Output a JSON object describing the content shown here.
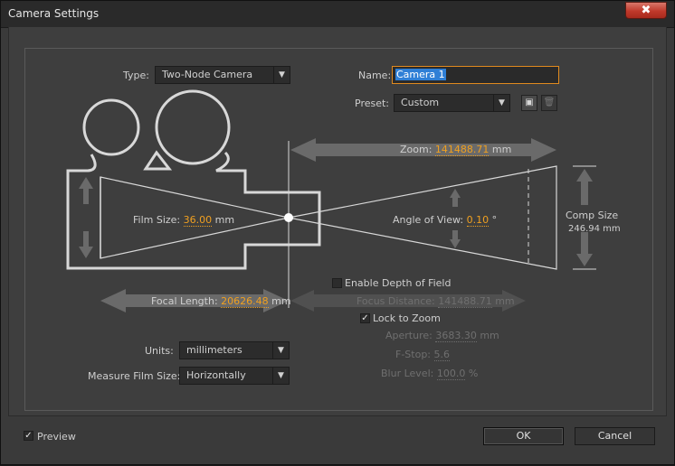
{
  "window": {
    "title": "Camera Settings",
    "close_label": "✖"
  },
  "type": {
    "label": "Type:",
    "value": "Two-Node Camera"
  },
  "name": {
    "label": "Name:",
    "value": "Camera 1"
  },
  "preset": {
    "label": "Preset:",
    "value": "Custom"
  },
  "diagram": {
    "zoom": {
      "label": "Zoom:",
      "value": "141488.71",
      "unit": "mm"
    },
    "film_size": {
      "label": "Film Size:",
      "value": "36.00",
      "unit": "mm"
    },
    "angle_of_view": {
      "label": "Angle of View:",
      "value": "0.10",
      "unit": "°"
    },
    "comp_size": {
      "label": "Comp Size",
      "value": "246.94 mm"
    },
    "focal_length": {
      "label": "Focal Length:",
      "value": "20626.48",
      "unit": "mm"
    }
  },
  "depth_of_field": {
    "enable_label": "Enable Depth of Field",
    "enabled": false,
    "focus_distance": {
      "label": "Focus Distance:",
      "value": "141488.71",
      "unit": "mm"
    },
    "lock_to_zoom_label": "Lock to Zoom",
    "lock_to_zoom": true,
    "aperture": {
      "label": "Aperture:",
      "value": "3683.30",
      "unit": "mm"
    },
    "fstop": {
      "label": "F-Stop:",
      "value": "5.6"
    },
    "blur_level": {
      "label": "Blur Level:",
      "value": "100.0",
      "unit": "%"
    }
  },
  "units": {
    "label": "Units:",
    "value": "millimeters"
  },
  "measure_film_size": {
    "label": "Measure Film Size:",
    "value": "Horizontally"
  },
  "footer": {
    "preview_label": "Preview",
    "preview_checked": true,
    "ok_label": "OK",
    "cancel_label": "Cancel"
  },
  "colors": {
    "accent": "#f0a020",
    "selection": "#2f7fd6",
    "close": "#c0392b"
  }
}
